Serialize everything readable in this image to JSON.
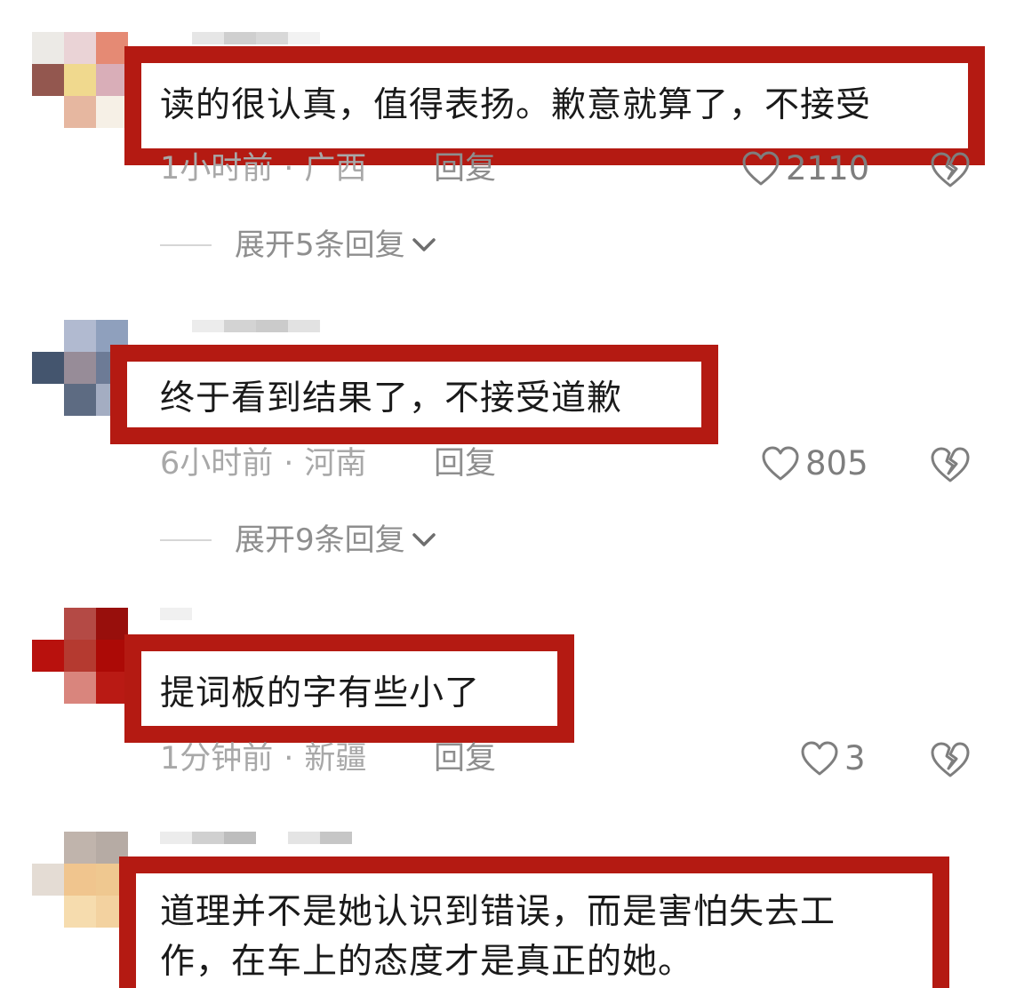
{
  "comments": [
    {
      "text": "读的很认真，值得表扬。歉意就算了，不接受",
      "time": "1小时前",
      "location": "广西",
      "reply_label": "回复",
      "likes": "2110",
      "expand_label": "展开5条回复"
    },
    {
      "text": "终于看到结果了，不接受道歉",
      "time": "6小时前",
      "location": "河南",
      "reply_label": "回复",
      "likes": "805",
      "expand_label": "展开9条回复"
    },
    {
      "text": "提词板的字有些小了",
      "time": "1分钟前",
      "location": "新疆",
      "reply_label": "回复",
      "likes": "3"
    },
    {
      "text_line1": "道理并不是她认识到错误，而是害怕失去工",
      "text_line2": "作，在车上的态度才是真正的她。"
    }
  ],
  "colors": {
    "highlight_border": "#b41a12",
    "meta_text": "#a8a8a8",
    "icon_stroke": "#7e7e7e"
  },
  "icons": {
    "like": "heart-outline-icon",
    "dislike": "broken-heart-icon",
    "expand": "chevron-down-icon"
  }
}
